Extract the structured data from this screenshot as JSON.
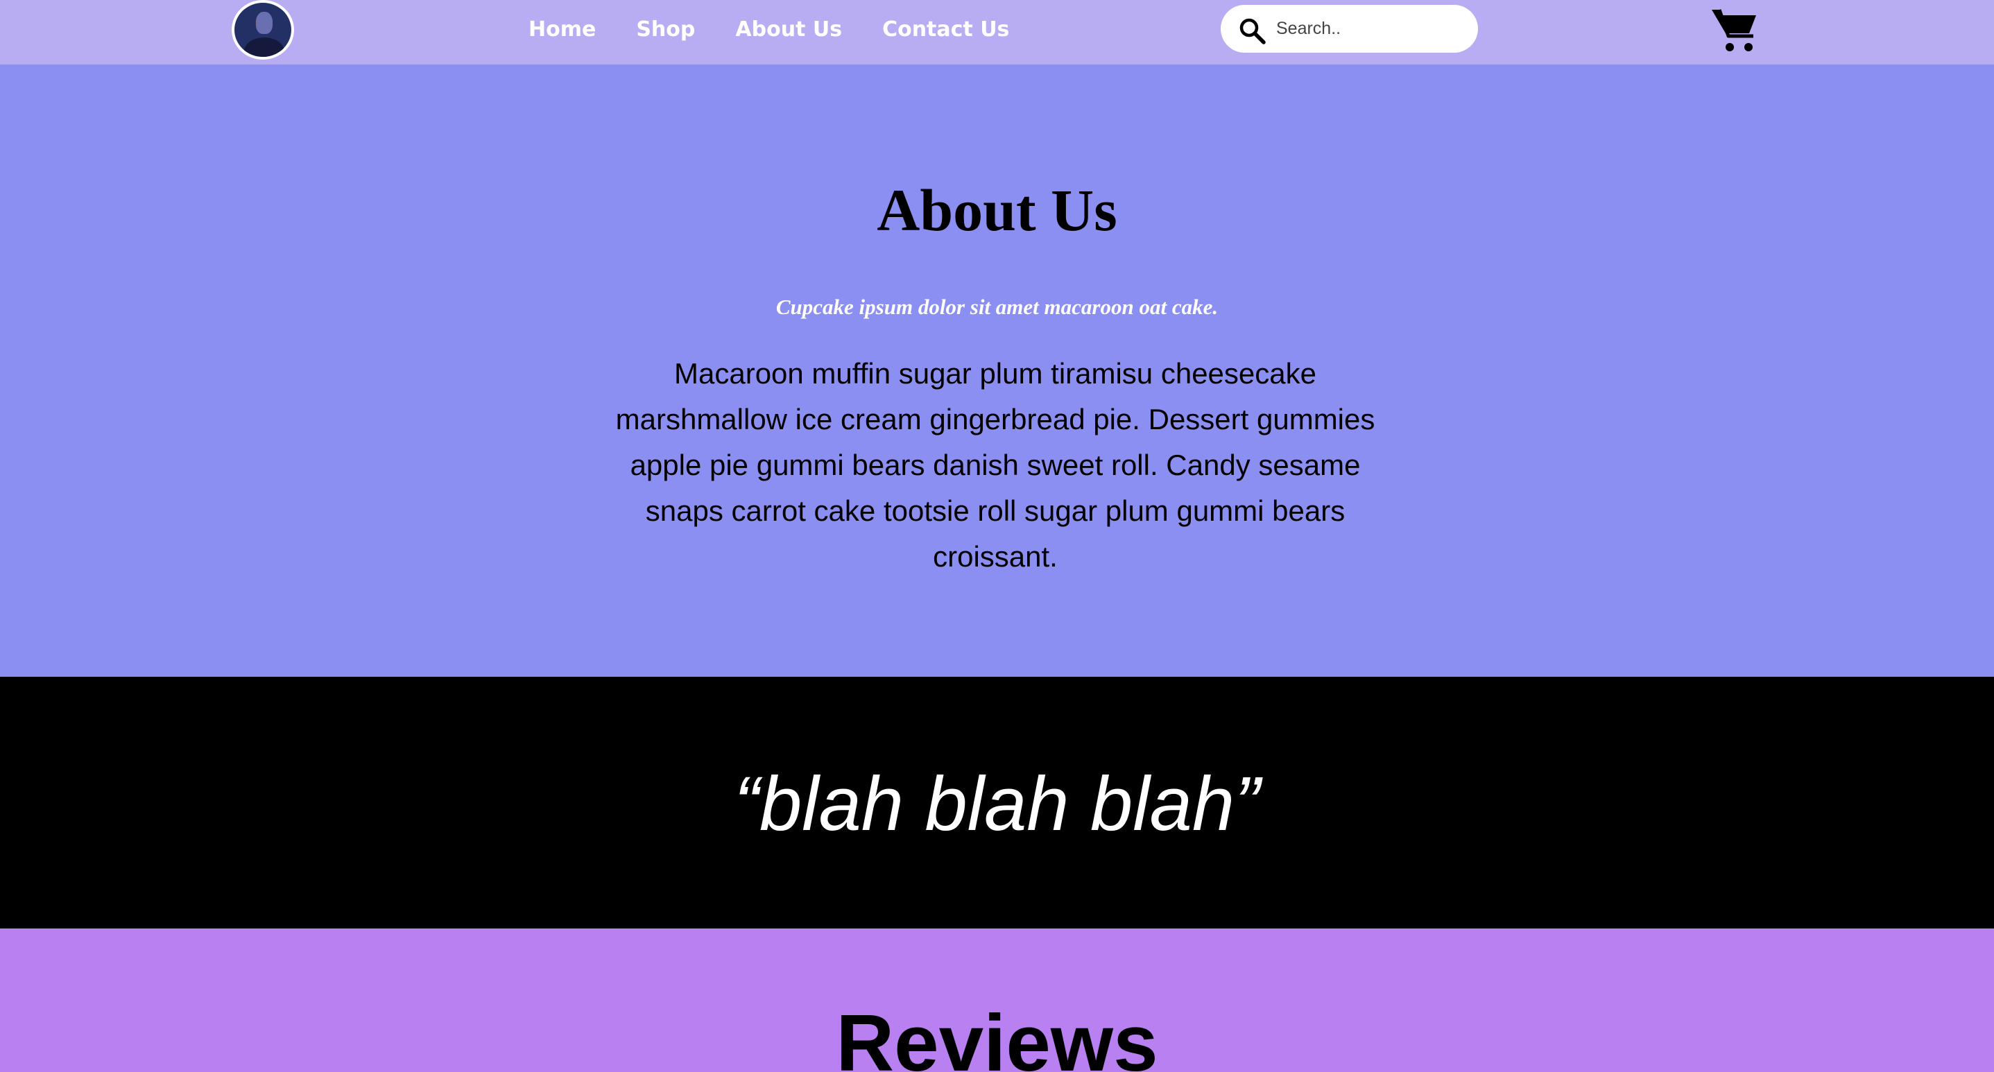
{
  "nav": {
    "avatar_icon": "user-avatar",
    "links": [
      "Home",
      "Shop",
      "About Us",
      "Contact Us"
    ],
    "search": {
      "placeholder": "Search..",
      "value": "",
      "icon": "search-icon"
    },
    "cart_icon": "shopping-cart-icon"
  },
  "about": {
    "title": "About Us",
    "subtitle": "Cupcake ipsum dolor sit amet macaroon oat cake.",
    "body": "Macaroon muffin sugar plum tiramisu cheesecake marshmallow ice cream gingerbread pie. Dessert gummies apple pie gummi bears danish sweet roll. Candy sesame snaps carrot cake tootsie roll sugar plum gummi bears croissant."
  },
  "quote": {
    "text": "“blah blah blah”"
  },
  "reviews": {
    "title": "Reviews"
  },
  "colors": {
    "navbar_bg": "#b8adf2",
    "about_bg": "#8c8ff2",
    "quote_bg": "#000000",
    "reviews_bg": "#b880f0",
    "text_light": "#ffffff",
    "text_dark": "#000000"
  }
}
